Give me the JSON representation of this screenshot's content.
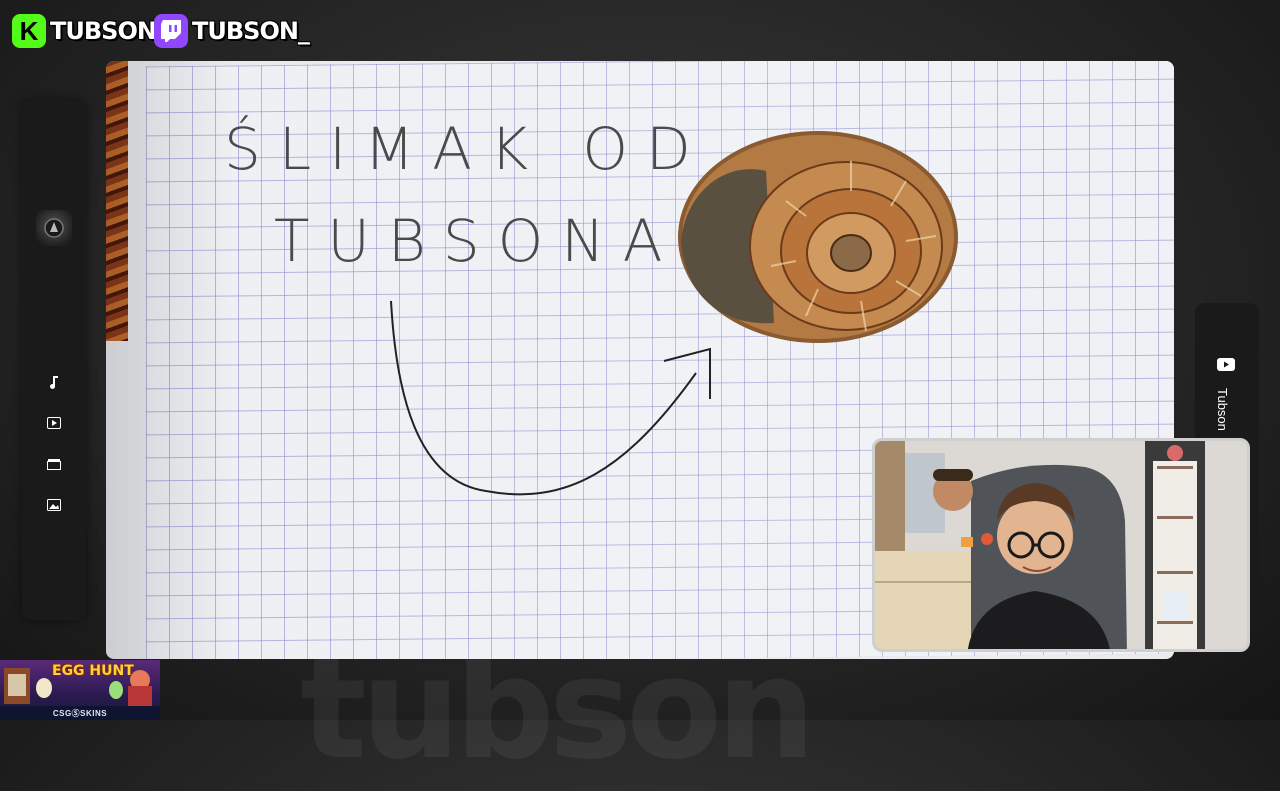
{
  "socials": [
    {
      "platform_icon": "kick-icon",
      "badge_letter": "K",
      "handle": "TUBSON",
      "color": "#53fc18"
    },
    {
      "platform_icon": "twitch-icon",
      "badge_letter": "",
      "handle": "TUBSON_",
      "color": "#9146ff"
    }
  ],
  "left_sidebar": {
    "icons": [
      "music-note-icon",
      "play-video-icon",
      "clapperboard-icon",
      "image-icon"
    ]
  },
  "main_camera": {
    "handwritten_line1": "ŚLIMAK OD",
    "handwritten_line2": "TUBSONA",
    "object": "ammonite-fossil"
  },
  "right_sidebar": {
    "icon": "youtube-icon",
    "label": "Tubson"
  },
  "sponsor": {
    "title": "EGG HUNT",
    "brand": "CSGⓈSKINS"
  },
  "watermark": "tubson"
}
